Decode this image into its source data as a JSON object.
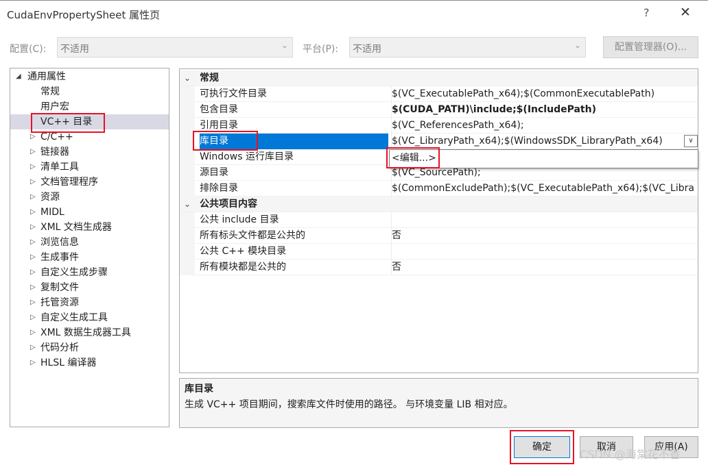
{
  "window": {
    "title": "CudaEnvPropertySheet 属性页",
    "help_glyph": "?",
    "close_glyph": "✕"
  },
  "config_bar": {
    "config_label": "配置(C):",
    "config_value": "不适用",
    "platform_label": "平台(P):",
    "platform_value": "不适用",
    "manager_button": "配置管理器(O)..."
  },
  "tree": {
    "root": "通用属性",
    "items": [
      {
        "label": "常规"
      },
      {
        "label": "用户宏"
      },
      {
        "label": "VC++ 目录"
      },
      {
        "label": "C/C++"
      },
      {
        "label": "链接器"
      },
      {
        "label": "清单工具"
      },
      {
        "label": "文档管理程序"
      },
      {
        "label": "资源"
      },
      {
        "label": "MIDL"
      },
      {
        "label": "XML 文档生成器"
      },
      {
        "label": "浏览信息"
      },
      {
        "label": "生成事件"
      },
      {
        "label": "自定义生成步骤"
      },
      {
        "label": "复制文件"
      },
      {
        "label": "托管资源"
      },
      {
        "label": "自定义生成工具"
      },
      {
        "label": "XML 数据生成器工具"
      },
      {
        "label": "代码分析"
      },
      {
        "label": "HLSL 编译器"
      }
    ]
  },
  "grid": {
    "category_general": "常规",
    "category_public": "公共项目内容",
    "rows": [
      {
        "name": "可执行文件目录",
        "value": "$(VC_ExecutablePath_x64);$(CommonExecutablePath)"
      },
      {
        "name": "包含目录",
        "value": "$(CUDA_PATH)\\include;$(IncludePath)"
      },
      {
        "name": "引用目录",
        "value": "$(VC_ReferencesPath_x64);"
      },
      {
        "name": "库目录",
        "value": "$(VC_LibraryPath_x64);$(WindowsSDK_LibraryPath_x64)"
      },
      {
        "name": "Windows 运行库目录",
        "value": ""
      },
      {
        "name": "源目录",
        "value": "$(VC_SourcePath);"
      },
      {
        "name": "排除目录",
        "value": "$(CommonExcludePath);$(VC_ExecutablePath_x64);$(VC_Libra"
      }
    ],
    "public_rows": [
      {
        "name": "公共 include 目录",
        "value": ""
      },
      {
        "name": "所有标头文件都是公共的",
        "value": "否"
      },
      {
        "name": "公共 C++ 模块目录",
        "value": ""
      },
      {
        "name": "所有模块都是公共的",
        "value": "否"
      }
    ],
    "dropdown_glyph": "∨",
    "edit_popup": "<编辑...>"
  },
  "description": {
    "title": "库目录",
    "text": "生成 VC++ 项目期间，搜索库文件时使用的路径。 与环境变量 LIB 相对应。"
  },
  "buttons": {
    "ok": "确定",
    "cancel": "取消",
    "apply": "应用(A)"
  },
  "watermark": "CSDN @海棠花不香",
  "colors": {
    "selection": "#0078d7",
    "highlight_box": "#e81123"
  }
}
